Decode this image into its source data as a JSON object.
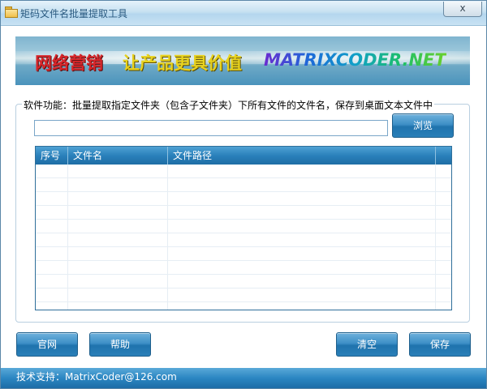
{
  "window": {
    "title": "矩码文件名批量提取工具",
    "close_label": "x"
  },
  "banner": {
    "part1": "网络营销",
    "part2": "让产品更具价值",
    "part3": "MATRIXCODER.NET"
  },
  "group": {
    "caption": "软件功能：批量提取指定文件夹（包含子文件夹）下所有文件的文件名，保存到桌面文本文件中"
  },
  "path_input": {
    "value": "",
    "placeholder": ""
  },
  "buttons": {
    "browse": "浏览",
    "website": "官网",
    "help": "帮助",
    "clear": "清空",
    "save": "保存"
  },
  "table": {
    "columns": [
      "序号",
      "文件名",
      "文件路径"
    ],
    "rows": []
  },
  "status": {
    "text": "技术支持：MatrixCoder@126.com"
  },
  "colors": {
    "accent": "#2a80bb",
    "statusbar": "#2b86c2",
    "title_text": "#2a5a80"
  }
}
